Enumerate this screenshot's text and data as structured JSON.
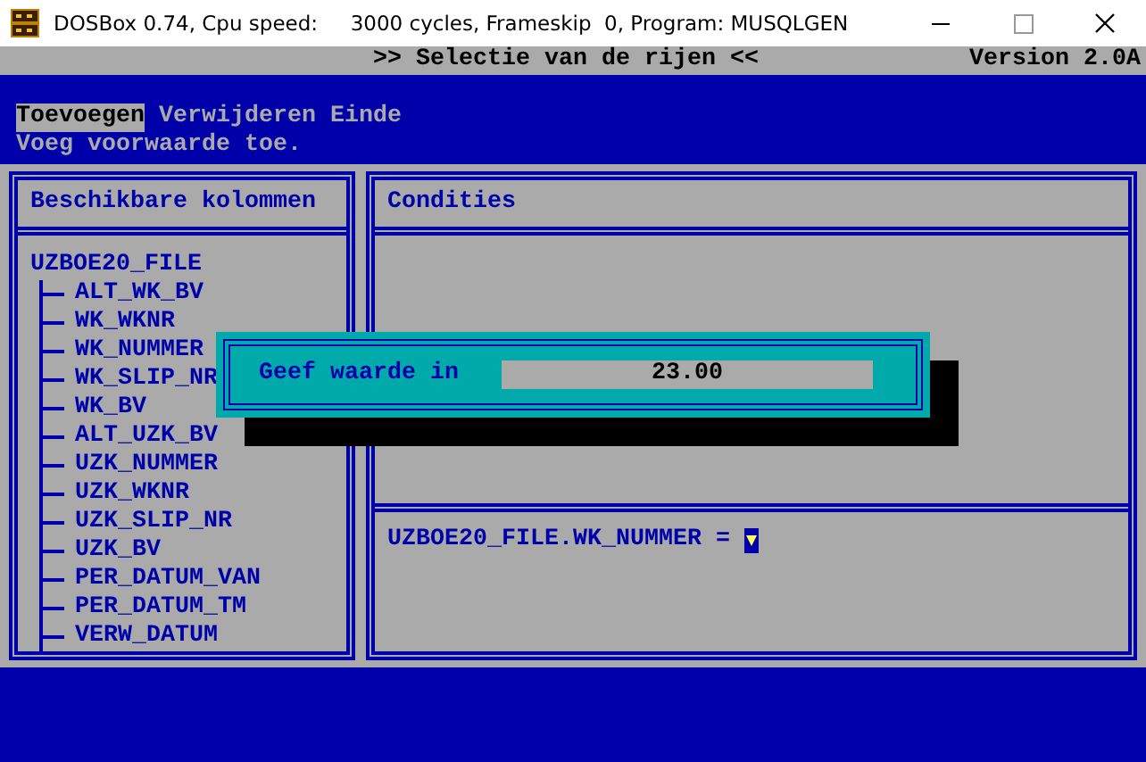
{
  "window": {
    "title": "DOSBox 0.74, Cpu speed:     3000 cycles, Frameskip  0, Program: MUSQLGEN"
  },
  "header": {
    "title": ">> Selectie van de rijen <<",
    "version": "Version 2.0A"
  },
  "menu": [
    {
      "label": "Toevoegen",
      "selected": true
    },
    {
      "label": "Verwijderen",
      "selected": false
    },
    {
      "label": "Einde",
      "selected": false
    }
  ],
  "hint": "Voeg voorwaarde toe.",
  "columns_panel": {
    "title": "Beschikbare kolommen",
    "tree": {
      "label": "UZBOE20_FILE",
      "children": [
        {
          "label": "ALT_WK_BV"
        },
        {
          "label": "WK_WKNR"
        },
        {
          "label": "WK_NUMMER"
        },
        {
          "label": "WK_SLIP_NR"
        },
        {
          "label": "WK_BV"
        },
        {
          "label": "ALT_UZK_BV"
        },
        {
          "label": "UZK_NUMMER"
        },
        {
          "label": "UZK_WKNR"
        },
        {
          "label": "UZK_SLIP_NR"
        },
        {
          "label": "UZK_BV"
        },
        {
          "label": "PER_DATUM_VAN"
        },
        {
          "label": "PER_DATUM_TM"
        },
        {
          "label": "VERW_DATUM"
        }
      ]
    }
  },
  "conditions_panel": {
    "title": "Condities",
    "expression": "UZBOE20_FILE.WK_NUMMER ="
  },
  "dialog": {
    "label": "Geef waarde in",
    "value": "23.00"
  }
}
